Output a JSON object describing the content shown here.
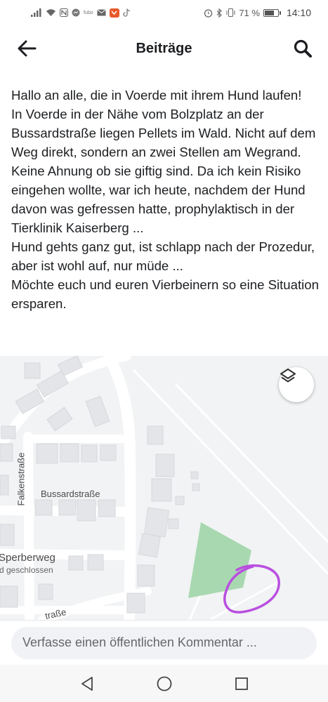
{
  "status_bar": {
    "battery_percent": "71 %",
    "time": "14:10",
    "battery_level": 0.71
  },
  "header": {
    "title": "Beiträge",
    "back_icon": "arrow-left-icon",
    "search_icon": "search-icon"
  },
  "post": {
    "text": "Hallo an alle, die in Voerde mit ihrem Hund laufen!\nIn Voerde in der Nähe vom Bolzplatz an der Bussardstraße liegen Pellets im Wald. Nicht auf dem Weg direkt, sondern an zwei Stellen am Wegrand.\nKeine Ahnung ob sie giftig sind. Da ich kein Risiko eingehen wollte, war ich heute, nachdem der Hund davon was gefressen hatte, prophylaktisch in der Tierklinik Kaiserberg ...\nHund gehts ganz gut, ist schlapp nach der Prozedur, aber ist wohl auf, nur müde ...\nMöchte euch und euren Vierbeinern so eine Situation ersparen."
  },
  "map": {
    "labels": {
      "falkenstrasse": "Falkenstraße",
      "bussardstrasse": "Bussardstraße",
      "sperberweg": "Sperberweg",
      "closed": "d geschlossen",
      "bottom_street": "traße"
    },
    "layers_icon": "layers-icon",
    "colors": {
      "park": "#a8d8b0",
      "highlight": "#b94fe0"
    }
  },
  "comment": {
    "placeholder": "Verfasse einen öffentlichen Kommentar ..."
  },
  "nav": {
    "back_icon": "triangle-back-icon",
    "home_icon": "circle-home-icon",
    "recents_icon": "square-recents-icon"
  }
}
